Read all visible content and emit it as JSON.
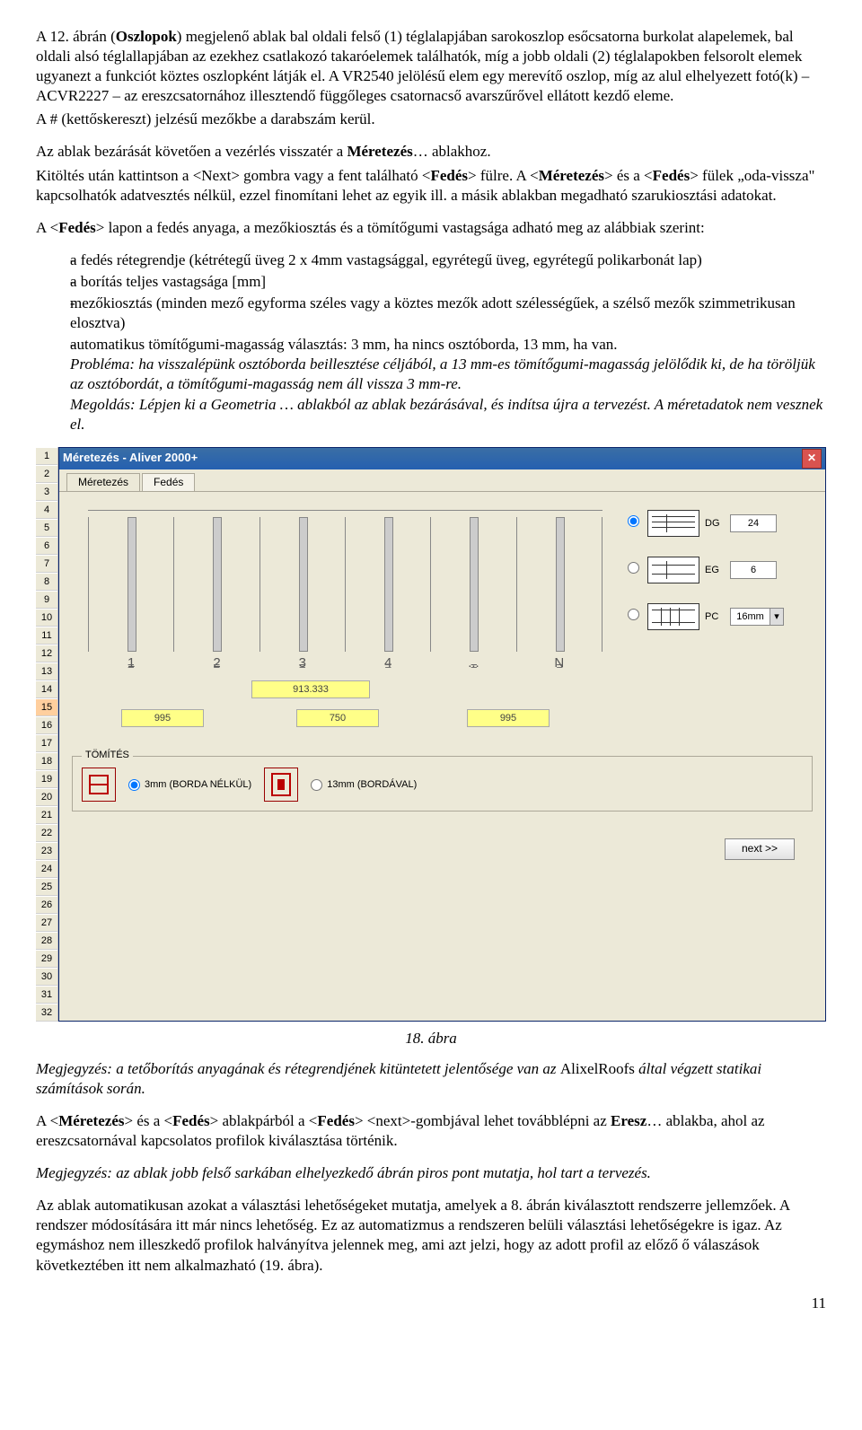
{
  "p1": "A 12. ábrán (",
  "p1b": "Oszlopok",
  "p1c": ") megjelenő ablak bal oldali felső (1) téglalapjában sarokoszlop esőcsatorna burkolat alapelemek, bal oldali alsó téglallapjában az ezekhez csatlakozó takaróelemek találhatók, míg a jobb oldali (2) téglalapokben felsorolt elemek ugyanezt a funkciót köztes oszlopként látják el. A VR2540 jelölésű elem egy merevítő oszlop, míg az alul elhelyezett fotó(k) – ACVR2227 – az ereszcsatornához illesztendő függőleges csatornacső avarszűrővel ellátott kezdő eleme.",
  "p2": "A # (kettőskereszt) jelzésű mezőkbe a darabszám kerül.",
  "p3a": "Az ablak bezárását követően a vezérlés visszatér a ",
  "p3b": "Méretezés",
  "p3c": "… ablakhoz.",
  "p4a": "Kitöltés után kattintson a <Next> gombra vagy a fent található <",
  "p4b": "Fedés",
  "p4c": "> fülre. A <",
  "p4d": "Méretezés",
  "p4e": "> és a <",
  "p4f": "Fedés",
  "p4g": "> fülek „oda-vissza\" kapcsolhatók adatvesztés nélkül, ezzel finomítani lehet az egyik ill. a másik ablakban megadható szarukiosztási adatokat.",
  "p5a": "A <",
  "p5b": "Fedés",
  "p5c": "> lapon a fedés anyaga, a mezőkiosztás és a tömítőgumi vastagsága adható meg az alábbiak szerint:",
  "list": {
    "i1": "a fedés rétegrendje (kétrétegű üveg 2 x 4mm vastagsággal, egyrétegű üveg, egyrétegű polikarbonát lap)",
    "i2": "a borítás teljes vastagsága [mm]",
    "i3": "mezőkiosztás (minden mező egyforma széles vagy a köztes mezők adott szélességűek, a szélső mezők szimmetrikusan elosztva)",
    "i4": "automatikus tömítőgumi-magasság választás: 3 mm, ha nincs osztóborda, 13 mm, ha van.",
    "i4it1": "Probléma: ha visszalépünk osztóborda beillesztése céljából, a 13 mm-es tömítőgumi-magasság jelölődik ki, de ha töröljük az osztóbordát, a tömítőgumi-magasság nem áll vissza 3 mm-re.",
    "i4it2": "Megoldás: Lépjen ki a Geometria … ablakból az ablak bezárásával, és indítsa újra a tervezést. A méretadatok nem vesznek el."
  },
  "app": {
    "title": "Méretezés - Aliver 2000+",
    "tab1": "Méretezés",
    "tab2": "Fedés",
    "bars": [
      "1",
      "2",
      "3",
      "4",
      "...",
      "N"
    ],
    "eq": "=",
    "val913": "913.333",
    "val995": "995",
    "val750": "750",
    "opts": {
      "dg": {
        "lbl": "DG",
        "val": "24"
      },
      "eg": {
        "lbl": "EG",
        "val": "6"
      },
      "pc": {
        "lbl": "PC",
        "val": "16mm"
      }
    },
    "tomites": {
      "legend": "TÖMÍTÉS",
      "opt1": "3mm (BORDA NÉLKÜL)",
      "opt2": "13mm (BORDÁVAL)"
    },
    "next": "next >>"
  },
  "figcap": "18. ábra",
  "m1a": "Megjegyzés: a tetőborítás anyagának és rétegrendjének kitüntetett jelentősége van az ",
  "m1b": "AlixelRoofs",
  "m1c": " által végzett statikai számítások során.",
  "p6a": "A <",
  "p6b": "Méretezés",
  "p6c": "> és a <",
  "p6d": "Fedés",
  "p6e": "> ablakpárból a <",
  "p6f": "Fedés",
  "p6g": "> <next>-gombjával lehet továbblépni az ",
  "p6h": "Eresz",
  "p6i": "… ablakba, ahol az ereszcsatornával kapcsolatos profilok kiválasztása történik.",
  "m2": "Megjegyzés: az ablak jobb felső sarkában elhelyezkedő ábrán piros pont mutatja, hol tart a tervezés.",
  "p7": "Az ablak automatikusan azokat a választási lehetőségeket mutatja, amelyek a 8. ábrán kiválasztott rendszerre jellemzőek. A rendszer módosítására itt már nincs lehetőség. Ez az automatizmus a rendszeren belüli választási lehetőségekre is igaz. Az egymáshoz nem illeszkedő profilok halványítva jelennek meg, ami azt jelzi, hogy az adott profil az előző ő válaszások következtében itt nem alkalmazható (19. ábra).",
  "pagenum": "11",
  "rownums": [
    "1",
    "2",
    "3",
    "4",
    "5",
    "6",
    "7",
    "8",
    "9",
    "10",
    "11",
    "12",
    "13",
    "14",
    "15",
    "16",
    "17",
    "18",
    "19",
    "20",
    "21",
    "22",
    "23",
    "24",
    "25",
    "26",
    "27",
    "28",
    "29",
    "30",
    "31",
    "32"
  ]
}
